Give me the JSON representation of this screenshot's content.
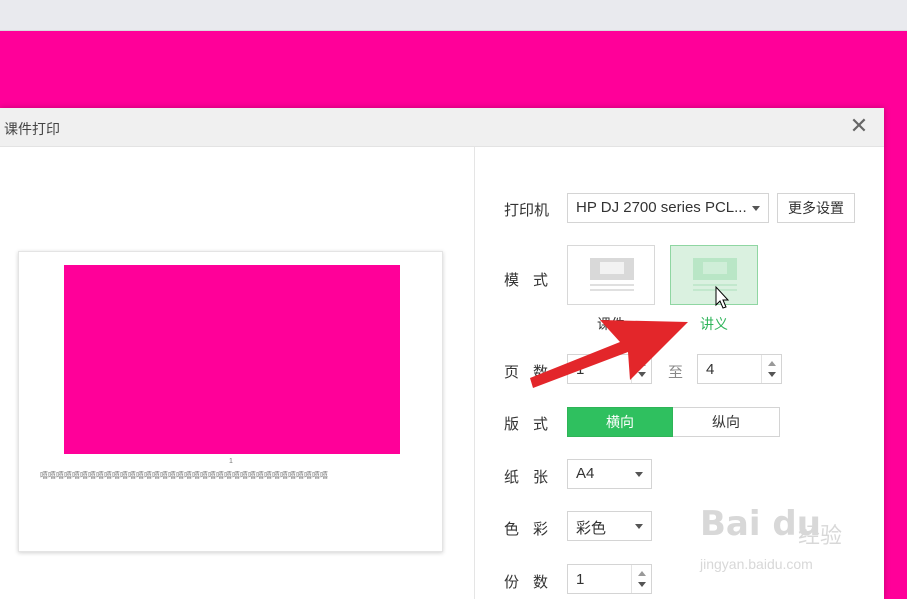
{
  "dialog": {
    "title": "课件打印",
    "close_symbol": "✕"
  },
  "preview": {
    "page_number": "1",
    "notes_text": "嘻嘻嘻嘻嘻嘻嘻嘻嘻嘻嘻嘻嘻嘻嘻嘻嘻嘻嘻嘻嘻嘻嘻嘻嘻嘻嘻嘻嘻嘻嘻嘻嘻嘻嘻嘻"
  },
  "settings": {
    "printer_label": "打印机",
    "printer_value": "HP DJ 2700 series PCL...",
    "more_settings": "更多设置",
    "mode_label": "模式",
    "mode_options": [
      "课件",
      "讲义"
    ],
    "mode_selected": "讲义",
    "pages_label": "页数",
    "pages_from": "1",
    "pages_to_label": "至",
    "pages_to": "4",
    "layout_label": "版式",
    "layout_options": [
      "横向",
      "纵向"
    ],
    "layout_selected": "横向",
    "paper_label": "纸张",
    "paper_value": "A4",
    "color_label": "色彩",
    "color_value": "彩色",
    "copies_label": "份数",
    "copies_value": "1"
  },
  "watermark": {
    "brand": "Bai du",
    "brand_cn": "经验",
    "url": "jingyan.baidu.com"
  },
  "colors": {
    "background_pink": "#ff0099",
    "accent_green": "#2fc05f",
    "annotation_red": "#e3262a"
  }
}
